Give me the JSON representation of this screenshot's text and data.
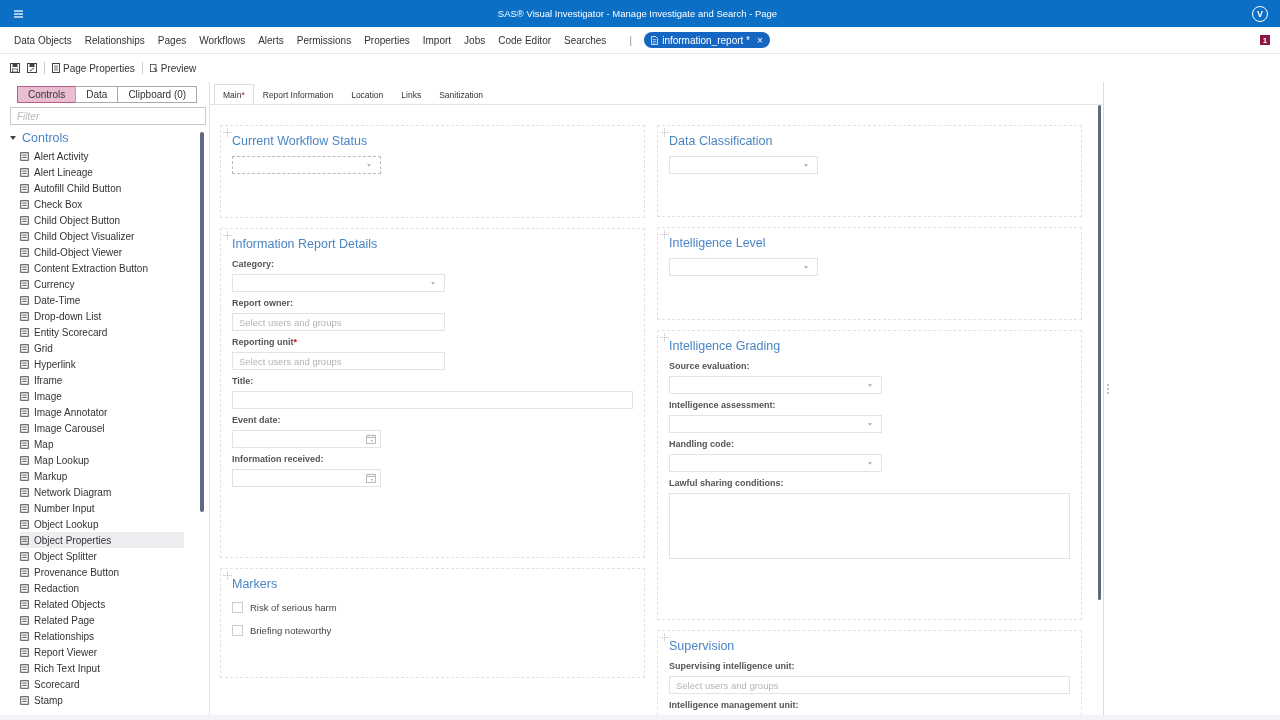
{
  "header": {
    "title": "SAS® Visual Investigator - Manage Investigate and Search - Page",
    "avatar": "V"
  },
  "nav": {
    "items": [
      "Data Objects",
      "Relationships",
      "Pages",
      "Workflows",
      "Alerts",
      "Permissions",
      "Properties",
      "Import",
      "Jobs",
      "Code Editor",
      "Searches"
    ],
    "separator": "|",
    "open_tab": {
      "label": "information_report *",
      "close": "×"
    },
    "badge": "1"
  },
  "toolbar": {
    "buttons": [
      {
        "kind": "properties",
        "label": "Page Properties"
      },
      {
        "kind": "preview",
        "label": "Preview"
      }
    ]
  },
  "left_panel": {
    "tabs": [
      {
        "label": "Controls",
        "selected": true
      },
      {
        "label": "Data",
        "selected": false
      },
      {
        "label": "Clipboard (0)",
        "selected": false
      }
    ],
    "filter": {
      "placeholder": "Filter"
    },
    "tree": {
      "label": "Controls",
      "expanded": true,
      "children": [
        {
          "label": "Alert Activity",
          "selected": false
        },
        {
          "label": "Alert Lineage",
          "selected": false
        },
        {
          "label": "Autofill Child Button",
          "selected": false
        },
        {
          "label": "Check Box",
          "selected": false
        },
        {
          "label": "Child Object Button",
          "selected": false
        },
        {
          "label": "Child Object Visualizer",
          "selected": false
        },
        {
          "label": "Child-Object Viewer",
          "selected": false
        },
        {
          "label": "Content Extraction Button",
          "selected": false
        },
        {
          "label": "Currency",
          "selected": false
        },
        {
          "label": "Date-Time",
          "selected": false
        },
        {
          "label": "Drop-down List",
          "selected": false
        },
        {
          "label": "Entity Scorecard",
          "selected": false
        },
        {
          "label": "Grid",
          "selected": false
        },
        {
          "label": "Hyperlink",
          "selected": false
        },
        {
          "label": "Iframe",
          "selected": false
        },
        {
          "label": "Image",
          "selected": false
        },
        {
          "label": "Image Annotator",
          "selected": false
        },
        {
          "label": "Image Carousel",
          "selected": false
        },
        {
          "label": "Map",
          "selected": false
        },
        {
          "label": "Map Lookup",
          "selected": false
        },
        {
          "label": "Markup",
          "selected": false
        },
        {
          "label": "Network Diagram",
          "selected": false
        },
        {
          "label": "Number Input",
          "selected": false
        },
        {
          "label": "Object Lookup",
          "selected": false
        },
        {
          "label": "Object Properties",
          "selected": true
        },
        {
          "label": "Object Splitter",
          "selected": false
        },
        {
          "label": "Provenance Button",
          "selected": false
        },
        {
          "label": "Redaction",
          "selected": false
        },
        {
          "label": "Related Objects",
          "selected": false
        },
        {
          "label": "Related Page",
          "selected": false
        },
        {
          "label": "Relationships",
          "selected": false
        },
        {
          "label": "Report Viewer",
          "selected": false
        },
        {
          "label": "Rich Text Input",
          "selected": false
        },
        {
          "label": "Scorecard",
          "selected": false
        },
        {
          "label": "Stamp",
          "selected": false
        }
      ]
    }
  },
  "page_tabs": [
    {
      "label": "Main",
      "flag": "*",
      "selected": true
    },
    {
      "label": "Report Information",
      "selected": false
    },
    {
      "label": "Location",
      "selected": false
    },
    {
      "label": "Links",
      "selected": false
    },
    {
      "label": "Sanitization",
      "selected": false
    }
  ],
  "columns": [
    [
      {
        "title": "Current Workflow Status",
        "fields": [
          {
            "kind": "select"
          }
        ]
      },
      {
        "title": "Information Report Details",
        "fields": [
          {
            "kind": "select",
            "label": "Category:"
          },
          {
            "kind": "people",
            "label": "Report owner:",
            "placeholder": "Select users and groups"
          },
          {
            "kind": "people",
            "label": "Reporting unit",
            "required_mark": "*",
            "placeholder": "Select users and groups"
          },
          {
            "kind": "text",
            "label": "Title:"
          },
          {
            "kind": "date",
            "label": "Event date:"
          },
          {
            "kind": "date",
            "label": "Information received:"
          }
        ]
      },
      {
        "title": "Markers",
        "fields": [
          {
            "kind": "checkbox",
            "label": "Risk of serious harm",
            "checked": false
          },
          {
            "kind": "checkbox",
            "label": "Briefing noteworthy",
            "checked": false
          }
        ]
      }
    ],
    [
      {
        "title": "Data Classification",
        "fields": [
          {
            "kind": "select"
          }
        ]
      },
      {
        "title": "Intelligence Level",
        "fields": [
          {
            "kind": "select"
          }
        ]
      },
      {
        "title": "Intelligence Grading",
        "fields": [
          {
            "kind": "select",
            "label": "Source evaluation:"
          },
          {
            "kind": "select",
            "label": "Intelligence assessment:"
          },
          {
            "kind": "select",
            "label": "Handling code:"
          },
          {
            "kind": "textarea",
            "label": "Lawful sharing conditions:"
          }
        ]
      },
      {
        "title": "Supervision",
        "fields": [
          {
            "kind": "people",
            "label": "Supervising intelligence unit:",
            "placeholder": "Select users and groups"
          },
          {
            "kind": "heading",
            "label": "Intelligence management unit:"
          }
        ]
      }
    ]
  ]
}
